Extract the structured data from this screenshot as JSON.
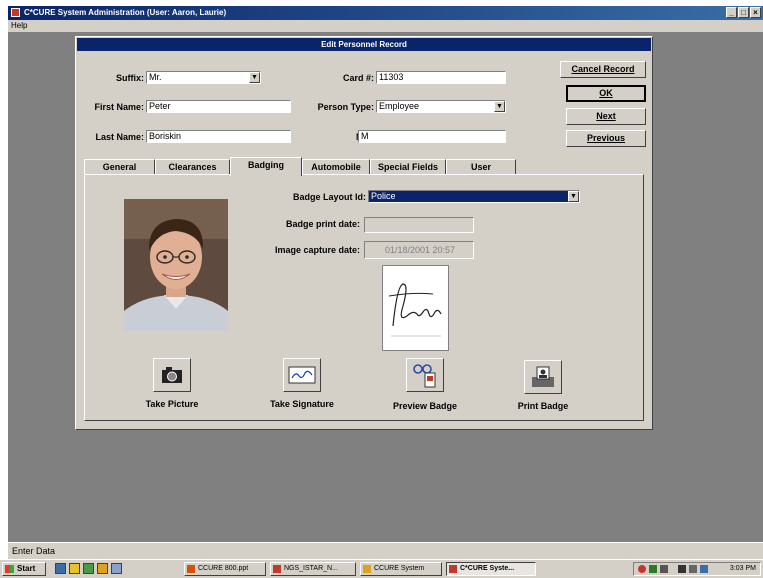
{
  "window": {
    "title": "C*CURE System Administration    (User: Aaron, Laurie)",
    "menu": [
      "Help"
    ],
    "controls": [
      "_",
      "□",
      "×"
    ]
  },
  "dialog": {
    "title": "Edit Personnel Record",
    "fields": {
      "suffix": {
        "label": "Suffix:",
        "value": "Mr."
      },
      "card": {
        "label": "Card #:",
        "value": "11303"
      },
      "first_name": {
        "label": "First Name:",
        "value": "Peter"
      },
      "person_type": {
        "label": "Person Type:",
        "value": "Employee"
      },
      "last_name": {
        "label": "Last Name:",
        "value": "Boriskin"
      },
      "mi": {
        "label": "M.I.:",
        "value": "M"
      }
    },
    "buttons": {
      "cancel": "Cancel Record",
      "ok": "OK",
      "next": "Next",
      "previous": "Previous"
    },
    "tabs": [
      {
        "label": "General",
        "active": false
      },
      {
        "label": "Clearances",
        "active": false
      },
      {
        "label": "Badging",
        "active": true
      },
      {
        "label": "Automobile",
        "active": false
      },
      {
        "label": "Special Fields",
        "active": false
      },
      {
        "label": "User",
        "active": false
      }
    ],
    "badging": {
      "layout_label": "Badge Layout Id:",
      "layout_value": "Police",
      "print_date_label": "Badge print date:",
      "print_date_value": "",
      "capture_date_label": "Image capture date:",
      "capture_date_value": "01/18/2001 20:57",
      "signature_text": "Boriskin"
    },
    "actions": {
      "take_picture": "Take Picture",
      "take_signature": "Take Signature",
      "preview_badge": "Preview Badge",
      "print_badge": "Print Badge"
    }
  },
  "status": {
    "text": "Enter Data"
  },
  "taskbar": {
    "start": "Start",
    "items": [
      {
        "label": "CCURE 800.ppt",
        "active": false
      },
      {
        "label": "NGS_ISTAR_N...",
        "active": false
      },
      {
        "label": "CCURE System",
        "active": false
      },
      {
        "label": "C*CURE Syste...",
        "active": true
      }
    ],
    "clock": "3:03 PM"
  },
  "colors": {
    "titlebar": "#0a246a",
    "face": "#d4d0c8",
    "desktop": "#808080",
    "selection": "#0a246a"
  }
}
